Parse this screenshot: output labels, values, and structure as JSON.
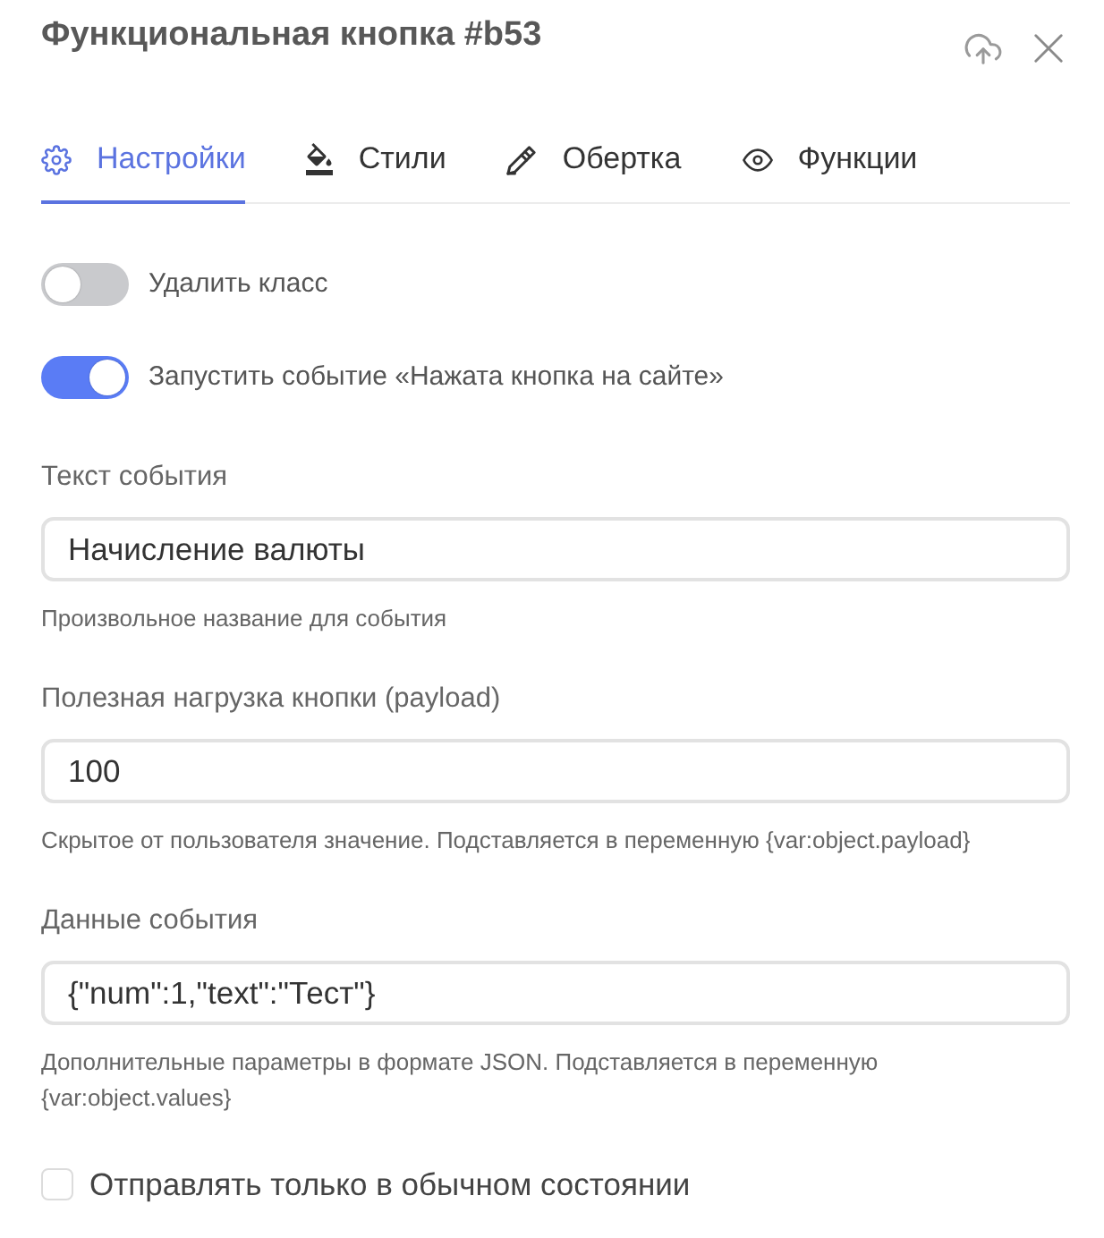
{
  "header": {
    "title": "Функциональная кнопка #b53"
  },
  "tabs": [
    {
      "label": "Настройки",
      "kind": "gear",
      "selected": true
    },
    {
      "label": "Стили",
      "kind": "fill",
      "selected": false
    },
    {
      "label": "Обертка",
      "kind": "pen",
      "selected": false
    },
    {
      "label": "Функции",
      "kind": "eye",
      "selected": false
    }
  ],
  "toggles": [
    {
      "label": "Удалить класс",
      "on": false
    },
    {
      "label": "Запустить событие «Нажата кнопка на сайте»",
      "on": true
    }
  ],
  "fields": [
    {
      "label": "Текст события",
      "value": "Начисление валюты",
      "hint": "Произвольное название для события"
    },
    {
      "label": "Полезная нагрузка кнопки (payload)",
      "value": "100",
      "hint": "Скрытое от пользователя значение. Подставляется в переменную {var:object.payload}"
    },
    {
      "label": "Данные события",
      "value": "{\"num\":1,\"text\":\"Тест\"}",
      "hint": "Дополнительные параметры в формате JSON. Подставляется в переменную {var:object.values}"
    }
  ],
  "checkbox": {
    "label": "Отправлять только в обычном состоянии",
    "checked": false
  }
}
